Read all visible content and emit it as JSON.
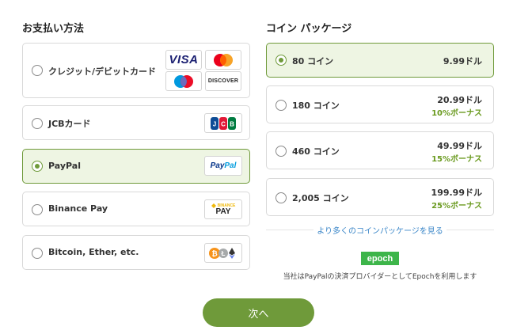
{
  "payment": {
    "heading": "お支払い方法",
    "methods": [
      {
        "label": "クレジット/デビットカード",
        "selected": false,
        "logos": [
          "VISA",
          "mastercard",
          "maestro",
          "DISCOVER"
        ]
      },
      {
        "label": "JCBカード",
        "selected": false,
        "logos": [
          "JCB"
        ]
      },
      {
        "label": "PayPal",
        "selected": true,
        "logos": [
          "PayPal"
        ]
      },
      {
        "label": "Binance Pay",
        "selected": false,
        "logos": [
          "BINANCE PAY"
        ]
      },
      {
        "label": "Bitcoin, Ether, etc.",
        "selected": false,
        "logos": [
          "crypto"
        ]
      }
    ],
    "logo_text": {
      "visa": "VISA",
      "discover": "DISCOVER",
      "jcb": "JCB",
      "paypal_pay": "Pay",
      "paypal_pal": "Pal",
      "binance_top": "BINANCE",
      "binance_bottom": "PAY"
    }
  },
  "coins": {
    "heading": "コイン パッケージ",
    "packages": [
      {
        "label": "80 コイン",
        "price": "9.99ドル",
        "bonus": "",
        "selected": true
      },
      {
        "label": "180 コイン",
        "price": "20.99ドル",
        "bonus": "10%ボーナス",
        "selected": false
      },
      {
        "label": "460 コイン",
        "price": "49.99ドル",
        "bonus": "15%ボーナス",
        "selected": false
      },
      {
        "label": "2,005 コイン",
        "price": "199.99ドル",
        "bonus": "25%ボーナス",
        "selected": false
      }
    ],
    "more_link": "より多くのコインパッケージを見る",
    "epoch_logo": "epoch",
    "epoch_note": "当社はPayPalの決済プロバイダーとしてEpochを利用します"
  },
  "next_button": "次へ",
  "colors": {
    "accent": "#6f9a3a",
    "selected_bg": "#eef5e3",
    "bonus": "#6a9a1f",
    "link": "#3a86c8",
    "epoch": "#3db54a"
  }
}
